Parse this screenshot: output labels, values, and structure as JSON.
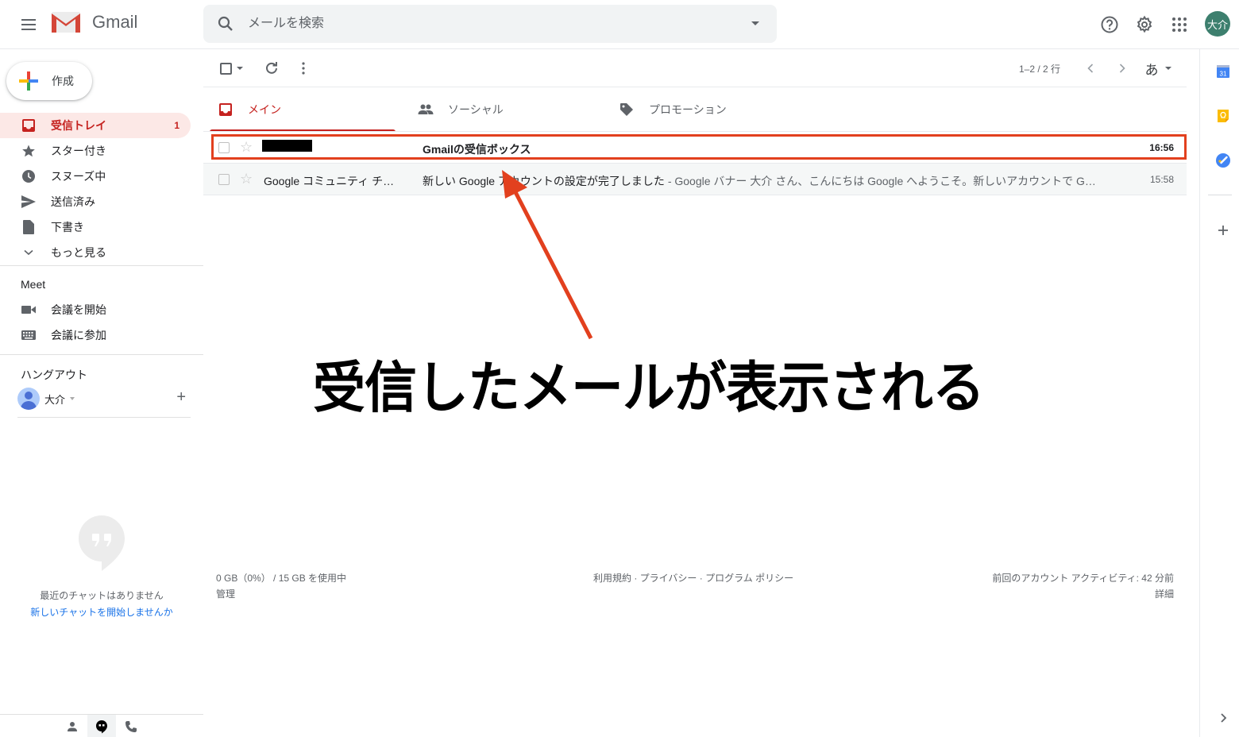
{
  "header": {
    "app_name": "Gmail",
    "search_placeholder": "メールを検索",
    "avatar_initials": "大介",
    "icons": [
      "menu-icon",
      "gmail-logo",
      "search-icon",
      "search-options-icon",
      "help-icon",
      "settings-icon",
      "apps-icon"
    ]
  },
  "sidebar": {
    "compose_label": "作成",
    "nav": [
      {
        "label": "受信トレイ",
        "count": "1",
        "icon": "inbox-icon",
        "active": true
      },
      {
        "label": "スター付き",
        "icon": "star-icon"
      },
      {
        "label": "スヌーズ中",
        "icon": "clock-icon"
      },
      {
        "label": "送信済み",
        "icon": "send-icon"
      },
      {
        "label": "下書き",
        "icon": "draft-icon"
      },
      {
        "label": "もっと見る",
        "icon": "chevron-down-icon"
      }
    ],
    "meet": {
      "title": "Meet",
      "items": [
        {
          "label": "会議を開始",
          "icon": "video-icon"
        },
        {
          "label": "会議に参加",
          "icon": "keyboard-icon"
        }
      ]
    },
    "hangouts": {
      "title": "ハングアウト",
      "user_name": "大介",
      "empty_text": "最近のチャットはありません",
      "start_link": "新しいチャットを開始しませんか"
    }
  },
  "toolbar": {
    "pager": "1–2 / 2 行",
    "input_tool": "あ"
  },
  "tabs": [
    {
      "label": "メイン",
      "icon": "inbox-icon",
      "active": true
    },
    {
      "label": "ソーシャル",
      "icon": "people-icon"
    },
    {
      "label": "プロモーション",
      "icon": "tag-icon"
    }
  ],
  "emails": [
    {
      "sender": "",
      "sender_redacted": true,
      "subject": "Gmailの受信ボックス",
      "snippet": "",
      "time": "16:56",
      "unread": true
    },
    {
      "sender": "Google コミュニティ チ…",
      "sender_redacted": false,
      "subject": "新しい Google アカウントの設定が完了しました",
      "snippet": " - Google バナー 大介 さん、こんにちは Google へようこそ。新しいアカウントで G…",
      "time": "15:58",
      "unread": false
    }
  ],
  "footer": {
    "storage": "0 GB（0%） / 15 GB を使用中",
    "manage": "管理",
    "links": "利用規約 · プライバシー · プログラム ポリシー",
    "activity": "前回のアカウント アクティビティ: 42 分前",
    "details": "詳細"
  },
  "side_panel": {
    "calendar_day": "31",
    "items": [
      "calendar-icon",
      "keep-icon",
      "tasks-icon",
      "add-icon"
    ]
  },
  "annotation": {
    "text": "受信したメールが表示される",
    "color": "#e2401e"
  }
}
